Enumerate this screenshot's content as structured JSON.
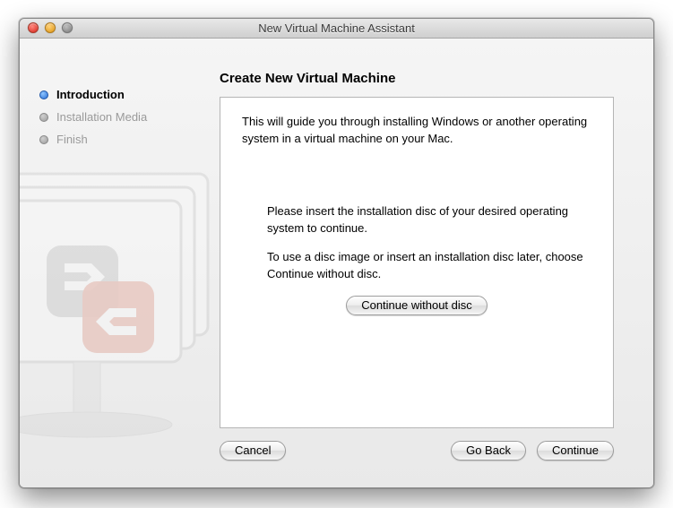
{
  "window": {
    "title": "New Virtual Machine Assistant"
  },
  "sidebar": {
    "steps": [
      {
        "label": "Introduction",
        "active": true
      },
      {
        "label": "Installation Media",
        "active": false
      },
      {
        "label": "Finish",
        "active": false
      }
    ]
  },
  "main": {
    "heading": "Create New Virtual Machine",
    "intro": "This will guide you through installing Windows or another operating system in a virtual machine on your Mac.",
    "insert_prompt": "Please insert the installation disc of your desired operating system to continue.",
    "disc_image_hint": "To use a disc image or insert an installation disc later, choose Continue without disc.",
    "continue_without_disc": "Continue without disc"
  },
  "buttons": {
    "cancel": "Cancel",
    "go_back": "Go Back",
    "continue": "Continue"
  }
}
